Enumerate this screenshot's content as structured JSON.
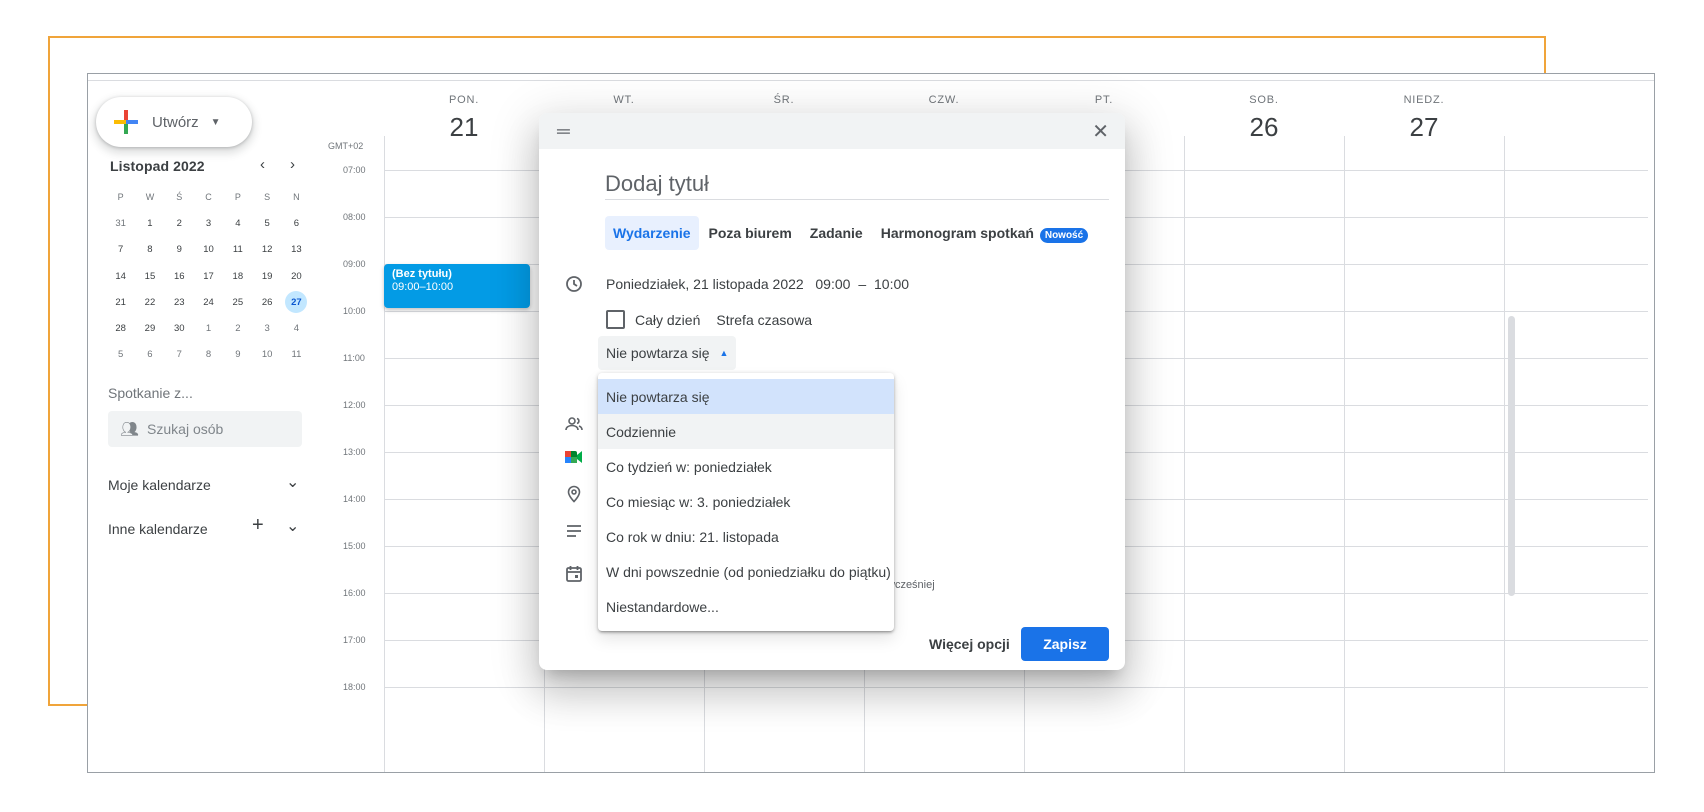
{
  "sidebar": {
    "create_label": "Utwórz",
    "mini_calendar": {
      "month_title": "Listopad 2022",
      "weekday_headers": [
        "P",
        "W",
        "Ś",
        "C",
        "P",
        "S",
        "N"
      ],
      "weeks": [
        [
          "31",
          "1",
          "2",
          "3",
          "4",
          "5",
          "6"
        ],
        [
          "7",
          "8",
          "9",
          "10",
          "11",
          "12",
          "13"
        ],
        [
          "14",
          "15",
          "16",
          "17",
          "18",
          "19",
          "20"
        ],
        [
          "21",
          "22",
          "23",
          "24",
          "25",
          "26",
          "27"
        ],
        [
          "28",
          "29",
          "30",
          "1",
          "2",
          "3",
          "4"
        ],
        [
          "5",
          "6",
          "7",
          "8",
          "9",
          "10",
          "11"
        ]
      ],
      "selected_day": "27"
    },
    "meet_with_label": "Spotkanie z...",
    "search_people_placeholder": "Szukaj osób",
    "my_calendars_label": "Moje kalendarze",
    "other_calendars_label": "Inne kalendarze"
  },
  "week": {
    "timezone": "GMT+02",
    "days": [
      {
        "name": "PON.",
        "num": "21"
      },
      {
        "name": "WT.",
        "num": ""
      },
      {
        "name": "ŚR.",
        "num": ""
      },
      {
        "name": "CZW.",
        "num": ""
      },
      {
        "name": "PT.",
        "num": ""
      },
      {
        "name": "SOB.",
        "num": "26"
      },
      {
        "name": "NIEDZ.",
        "num": "27"
      }
    ],
    "hours": [
      "07:00",
      "08:00",
      "09:00",
      "10:00",
      "11:00",
      "12:00",
      "13:00",
      "14:00",
      "15:00",
      "16:00",
      "17:00",
      "18:00"
    ],
    "event": {
      "title": "(Bez tytułu)",
      "time": "09:00–10:00",
      "color": "#039be5"
    }
  },
  "dialog": {
    "title_placeholder": "Dodaj tytuł",
    "tabs": [
      "Wydarzenie",
      "Poza biurem",
      "Zadanie",
      "Harmonogram spotkań"
    ],
    "active_tab": "Wydarzenie",
    "new_badge": "Nowość",
    "date_text": "Poniedziałek, 21 listopada 2022",
    "start_time": "09:00",
    "dash": "–",
    "end_time": "10:00",
    "all_day_label": "Cały dzień",
    "timezone_label": "Strefa czasowa",
    "repeat_value": "Nie powtarza się",
    "partial_text": "wcześniej",
    "more_options": "Więcej opcji",
    "save": "Zapisz",
    "accent_color": "#1a73e8"
  },
  "repeat_menu": {
    "options": [
      "Nie powtarza się",
      "Codziennie",
      "Co tydzień w: poniedziałek",
      "Co miesiąc w: 3. poniedziałek",
      "Co rok w dniu: 21. listopada",
      "W dni powszednie (od poniedziałku do piątku)",
      "Niestandardowe..."
    ],
    "selected_index": 0,
    "hover_index": 1
  }
}
